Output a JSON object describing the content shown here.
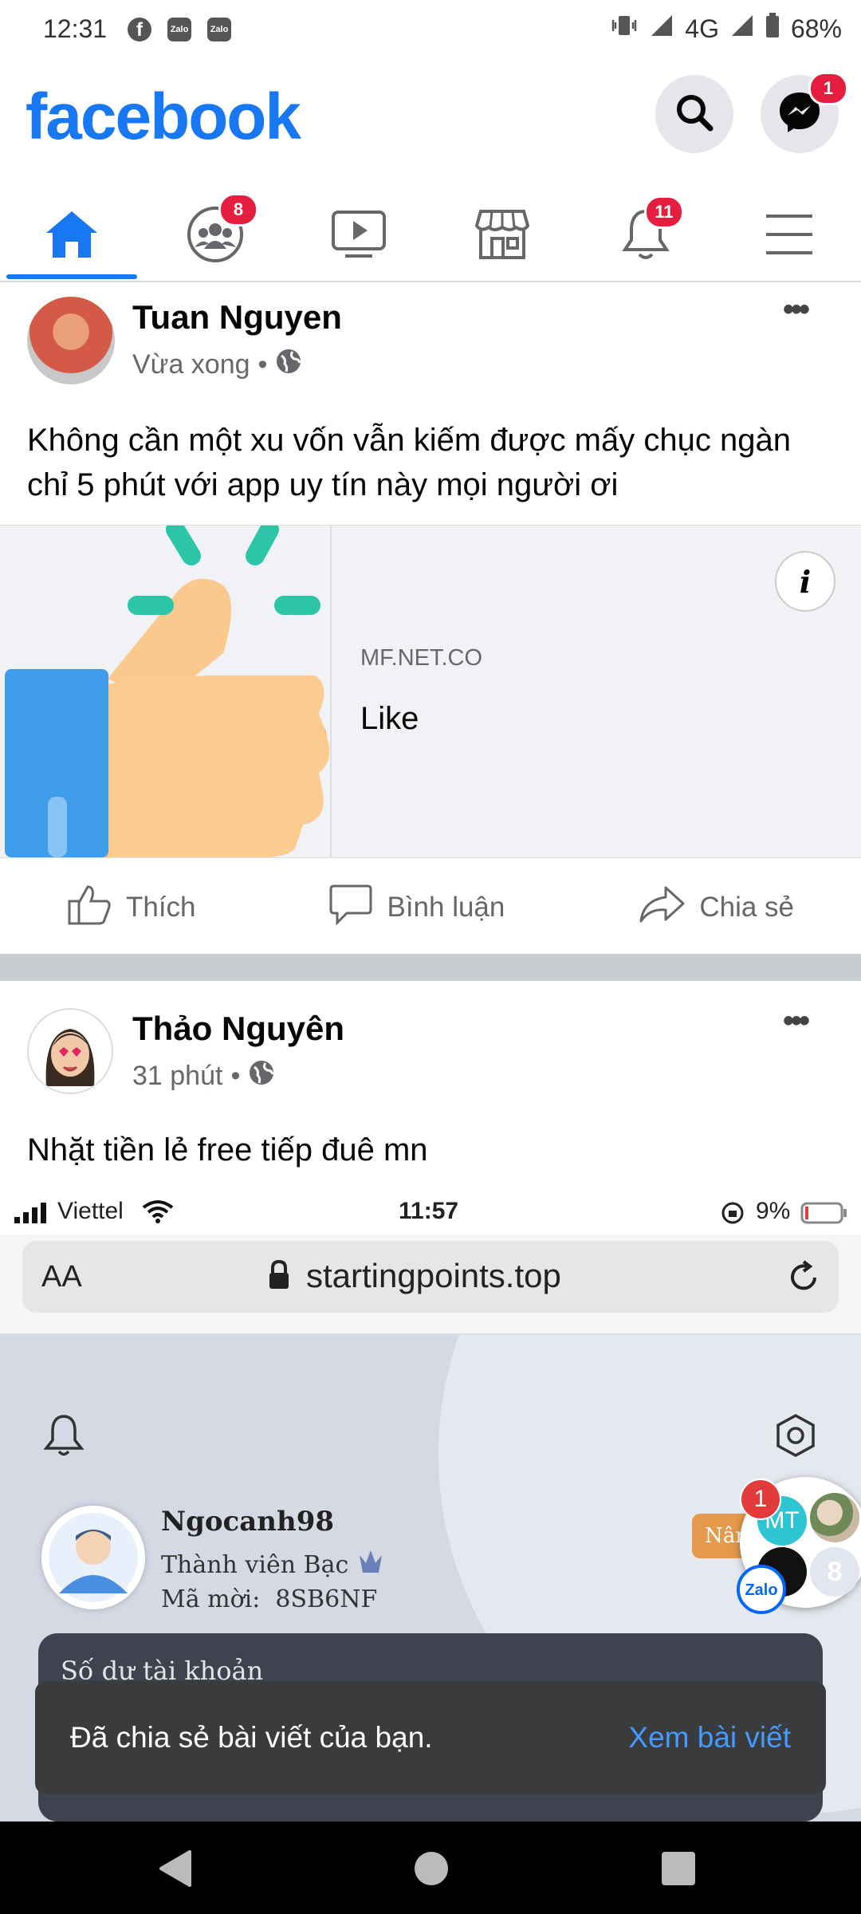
{
  "status_bar": {
    "time": "12:31",
    "app_icons": [
      "facebook-icon",
      "zalo-icon",
      "zalo-icon"
    ],
    "zalo_label": "Zalo",
    "network": "4G",
    "battery": "68%"
  },
  "header": {
    "logo": "facebook",
    "messenger_badge": "1"
  },
  "nav": {
    "tabs": [
      {
        "name": "home",
        "icon": "home-icon",
        "active": true
      },
      {
        "name": "groups",
        "icon": "groups-icon",
        "badge": "8"
      },
      {
        "name": "watch",
        "icon": "video-icon"
      },
      {
        "name": "marketplace",
        "icon": "store-icon"
      },
      {
        "name": "notifications",
        "icon": "bell-icon",
        "badge": "11"
      },
      {
        "name": "menu",
        "icon": "hamburger-icon"
      }
    ]
  },
  "post1": {
    "author": "Tuan Nguyen",
    "time": "Vừa xong",
    "text": "Không cần một xu vốn vẫn kiếm được mấy chục ngàn chỉ 5 phút với app uy tín này mọi người ơi",
    "link_domain": "MF.NET.CO",
    "link_title": "Like",
    "link_info": "i"
  },
  "actions": {
    "like": "Thích",
    "comment": "Bình luận",
    "share": "Chia sẻ"
  },
  "post2": {
    "author": "Thảo Nguyên",
    "time": "31 phút",
    "text": "Nhặt tiền lẻ free tiếp đuê mn",
    "screenshot": {
      "carrier": "Viettel",
      "time": "11:57",
      "battery": "9%",
      "aa": "AA",
      "url": "startingpoints.top",
      "username": "Ngocanh98",
      "member_level": "Thành viên Bạc",
      "invite_code": "Mã mời:  8SB6NF",
      "upgrade_label": "Nân",
      "balance_label": "Số dư tài khoản"
    }
  },
  "chat_bubble": {
    "badge": "1",
    "initials": "MT",
    "count": "8",
    "brand": "Zalo"
  },
  "snackbar": {
    "message": "Đã chia sẻ bài viết của bạn.",
    "action": "Xem bài viết"
  }
}
